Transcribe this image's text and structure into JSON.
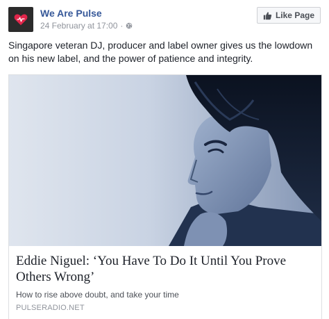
{
  "page": {
    "name": "We Are Pulse",
    "timestamp": "24 February at 17:00",
    "separator": "·",
    "avatar_icon": "heart-icon",
    "privacy_icon": "globe-icon",
    "accent_color": "#e0254a"
  },
  "like_button": {
    "label": "Like Page",
    "icon": "thumbs-up-icon"
  },
  "post": {
    "text": "Singapore veteran DJ, producer and label owner gives us the lowdown on his new label, and the power of patience and integrity."
  },
  "link_preview": {
    "title": "Eddie Niguel: ‘You Have To Do It Until You Prove Others Wrong’",
    "description": "How to rise above doubt, and take your time",
    "domain": "PULSERADIO.NET"
  }
}
